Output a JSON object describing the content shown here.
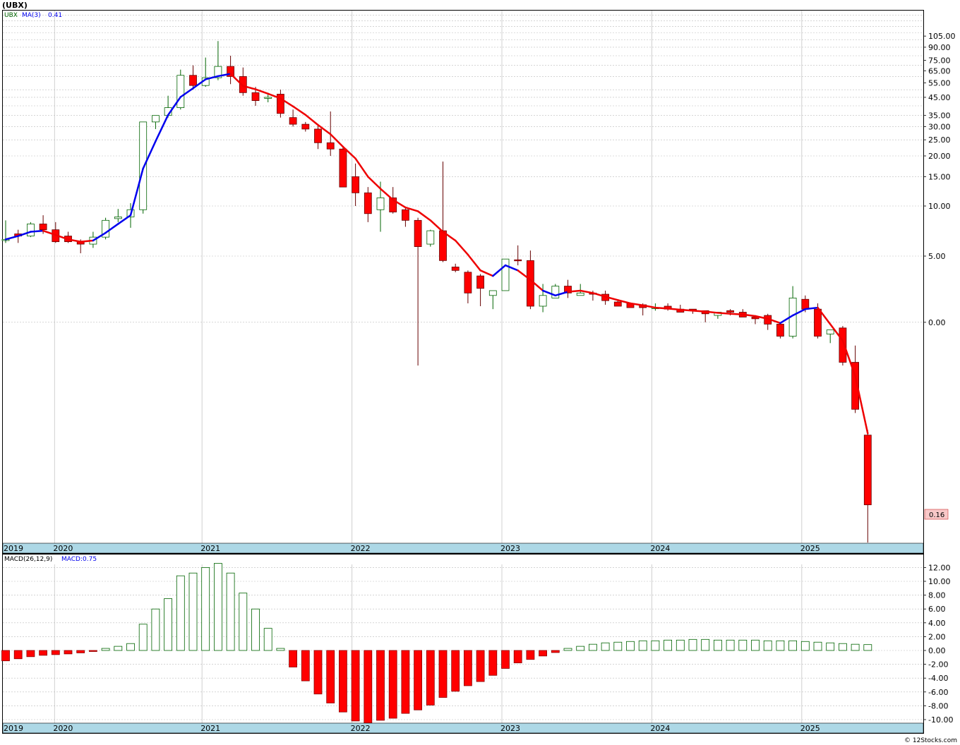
{
  "header": {
    "title": "(UBX)"
  },
  "colors": {
    "up": "#ffffff",
    "upStroke": "#006400",
    "down": "#ff0000",
    "downStroke": "#660000",
    "ma_rising": "#0000ee",
    "ma_falling": "#ee0000",
    "axis_band": "#add8e6",
    "hist_pos_stroke": "#006400",
    "last_label_bg": "#f8c8c8",
    "grid": "#b4b4b4"
  },
  "price_legend": {
    "symbol": "UBX",
    "ma_label": "MA(3)",
    "ma_value": "0.41"
  },
  "macd_legend": {
    "label": "MACD(26,12,9)",
    "value_label": "MACD:0.75"
  },
  "last_price_label": "0.16",
  "footer": {
    "credit": "© 12Stocks.com"
  },
  "chart_data": [
    {
      "type": "candlestick",
      "title": "(UBX)",
      "interval": "monthly",
      "scale": "log",
      "y_tick_labels": [
        "105.00",
        "90.00",
        "75.00",
        "65.00",
        "55.00",
        "45.00",
        "35.00",
        "30.00",
        "25.00",
        "20.00",
        "15.00",
        "10.00",
        "5.00",
        "0.00"
      ],
      "y_tick_values": [
        105,
        90,
        75,
        65,
        55,
        45,
        35,
        30,
        25,
        20,
        15,
        10,
        5,
        2
      ],
      "x_year_labels": [
        "2019",
        "2020",
        "2021",
        "2022",
        "2023",
        "2024",
        "2025"
      ],
      "x_year_positions": [
        0,
        4.2,
        16,
        28,
        40,
        52,
        64
      ],
      "first_year_at_left_edge": true,
      "candles_ohlc": [
        [
          6.2,
          8.2,
          6.0,
          6.3
        ],
        [
          6.8,
          7.2,
          6.0,
          6.6
        ],
        [
          6.6,
          8.0,
          6.5,
          7.8
        ],
        [
          7.8,
          8.8,
          6.8,
          7.2
        ],
        [
          7.2,
          8.0,
          6.0,
          6.1
        ],
        [
          6.6,
          7.0,
          6.0,
          6.1
        ],
        [
          6.1,
          6.3,
          5.2,
          5.9
        ],
        [
          5.9,
          7.0,
          5.6,
          6.5
        ],
        [
          6.5,
          8.5,
          6.3,
          8.2
        ],
        [
          8.4,
          9.6,
          8.0,
          8.6
        ],
        [
          8.6,
          10.4,
          7.4,
          9.5
        ],
        [
          9.5,
          16,
          9.0,
          32
        ],
        [
          32,
          35,
          29,
          35
        ],
        [
          35,
          46,
          34,
          39
        ],
        [
          39,
          66,
          38,
          61
        ],
        [
          61,
          70,
          50,
          53
        ],
        [
          53,
          78,
          52,
          59
        ],
        [
          59,
          98,
          57,
          69
        ],
        [
          69,
          80,
          54,
          60
        ],
        [
          60,
          68,
          46,
          48
        ],
        [
          48,
          52,
          40,
          43
        ],
        [
          45,
          47,
          42,
          45
        ],
        [
          47,
          50,
          34,
          36
        ],
        [
          34,
          38,
          30,
          31
        ],
        [
          31,
          32,
          28,
          29
        ],
        [
          29,
          31,
          22,
          24
        ],
        [
          24,
          37,
          20,
          22
        ],
        [
          22,
          23,
          14,
          13
        ],
        [
          15,
          18,
          10,
          12
        ],
        [
          12,
          13,
          8,
          9
        ],
        [
          9.5,
          14,
          7,
          11.2
        ],
        [
          11.2,
          13,
          9,
          9.2
        ],
        [
          9.5,
          9.8,
          7.5,
          8.2
        ],
        [
          8.2,
          8.5,
          1.1,
          5.7
        ],
        [
          5.9,
          7.2,
          5.7,
          7.1
        ],
        [
          7.1,
          18.5,
          4.6,
          4.7
        ],
        [
          4.3,
          4.5,
          4.0,
          4.1
        ],
        [
          4.0,
          4.1,
          2.6,
          3.0
        ],
        [
          3.8,
          3.9,
          2.5,
          3.2
        ],
        [
          2.9,
          3.1,
          2.4,
          3.1
        ],
        [
          3.1,
          4.8,
          3.1,
          4.8
        ],
        [
          4.75,
          5.8,
          4.4,
          4.7
        ],
        [
          4.7,
          5.4,
          2.4,
          2.5
        ],
        [
          2.5,
          3.4,
          2.3,
          2.9
        ],
        [
          2.8,
          3.4,
          2.8,
          3.3
        ],
        [
          3.3,
          3.6,
          2.8,
          3.0
        ],
        [
          2.9,
          3.4,
          2.9,
          3.0
        ],
        [
          3.0,
          3.1,
          2.7,
          2.95
        ],
        [
          2.95,
          3.1,
          2.55,
          2.7
        ],
        [
          2.65,
          2.7,
          2.5,
          2.5
        ],
        [
          2.6,
          2.6,
          2.5,
          2.45
        ],
        [
          2.55,
          2.6,
          2.2,
          2.45
        ],
        [
          2.45,
          2.6,
          2.35,
          2.45
        ],
        [
          2.5,
          2.6,
          2.35,
          2.4
        ],
        [
          2.4,
          2.55,
          2.3,
          2.3
        ],
        [
          2.4,
          2.4,
          2.25,
          2.35
        ],
        [
          2.35,
          2.35,
          2.0,
          2.25
        ],
        [
          2.2,
          2.3,
          2.1,
          2.3
        ],
        [
          2.35,
          2.4,
          2.2,
          2.3
        ],
        [
          2.3,
          2.4,
          2.15,
          2.15
        ],
        [
          2.15,
          2.2,
          1.95,
          2.1
        ],
        [
          2.2,
          2.25,
          1.8,
          1.95
        ],
        [
          1.95,
          2.0,
          1.6,
          1.65
        ],
        [
          1.65,
          3.3,
          1.6,
          2.8
        ],
        [
          2.75,
          2.9,
          2.3,
          2.4
        ],
        [
          2.4,
          2.6,
          1.6,
          1.65
        ],
        [
          1.7,
          1.8,
          1.5,
          1.8
        ],
        [
          1.85,
          1.9,
          1.1,
          1.15
        ],
        [
          1.15,
          1.45,
          0.57,
          0.6
        ],
        [
          0.42,
          0.45,
          0.095,
          0.16
        ]
      ],
      "ma_values": [
        6.3,
        6.6,
        7.0,
        7.1,
        6.7,
        6.3,
        6.1,
        6.2,
        6.9,
        7.8,
        8.8,
        16.8,
        24.5,
        35.2,
        45.2,
        51.0,
        57.7,
        60.3,
        62.3,
        52.7,
        50.3,
        47.3,
        44.3,
        39.7,
        35.3,
        30.7,
        27.0,
        22.7,
        19.3,
        15.0,
        12.7,
        10.9,
        9.8,
        9.3,
        8.2,
        7.0,
        6.2,
        5.1,
        4.1,
        3.8,
        4.4,
        4.1,
        3.6,
        3.1,
        2.9,
        3.05,
        3.1,
        3.0,
        2.85,
        2.72,
        2.6,
        2.53,
        2.45,
        2.42,
        2.38,
        2.35,
        2.32,
        2.28,
        2.25,
        2.23,
        2.18,
        2.1,
        1.98,
        2.2,
        2.4,
        2.45,
        1.95,
        1.55,
        0.95,
        0.43
      ],
      "ma_direction_up": [
        true,
        true,
        true,
        false,
        false,
        false,
        false,
        true,
        true,
        true,
        true,
        true,
        true,
        true,
        true,
        true,
        true,
        true,
        false,
        false,
        false,
        false,
        false,
        false,
        false,
        false,
        false,
        false,
        false,
        false,
        false,
        false,
        false,
        false,
        false,
        false,
        false,
        false,
        false,
        true,
        true,
        false,
        false,
        true,
        true,
        false,
        false,
        false,
        false,
        false,
        false,
        false,
        false,
        false,
        false,
        false,
        false,
        false,
        false,
        false,
        false,
        false,
        true,
        true,
        true,
        false,
        false,
        false,
        false,
        false
      ]
    },
    {
      "type": "bar",
      "title": "MACD(26,12,9)",
      "ylim": [
        -10.5,
        13
      ],
      "y_tick_values": [
        12,
        10,
        8,
        6,
        4,
        2,
        0,
        -2,
        -4,
        -6,
        -8,
        -10
      ],
      "y_tick_labels": [
        "12.00",
        "10.00",
        "8.00",
        "6.00",
        "4.00",
        "2.00",
        "0.00",
        "-2.00",
        "-4.00",
        "-6.00",
        "-8.00",
        "-10.00"
      ],
      "values": [
        -1.5,
        -1.2,
        -0.9,
        -0.7,
        -0.6,
        -0.5,
        -0.35,
        -0.15,
        0.3,
        0.6,
        1.0,
        3.8,
        6.0,
        7.5,
        10.8,
        11.2,
        12.0,
        12.6,
        11.2,
        8.3,
        6.0,
        3.2,
        0.3,
        -2.4,
        -4.4,
        -6.3,
        -7.6,
        -8.9,
        -10.2,
        -10.5,
        -10.1,
        -9.8,
        -9.1,
        -8.6,
        -7.9,
        -6.8,
        -5.9,
        -5.1,
        -4.5,
        -3.6,
        -2.6,
        -1.8,
        -1.3,
        -0.8,
        -0.3,
        0.3,
        0.6,
        0.9,
        1.1,
        1.2,
        1.3,
        1.4,
        1.4,
        1.5,
        1.5,
        1.6,
        1.6,
        1.5,
        1.5,
        1.5,
        1.5,
        1.4,
        1.4,
        1.4,
        1.3,
        1.2,
        1.1,
        1.0,
        0.9,
        0.85
      ],
      "x_year_labels": [
        "2019",
        "2020",
        "2021",
        "2022",
        "2023",
        "2024",
        "2025"
      ]
    }
  ]
}
